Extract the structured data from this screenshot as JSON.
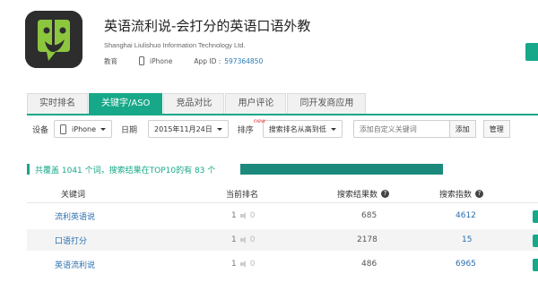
{
  "app": {
    "title": "英语流利说-会打分的英语口语外教",
    "company": "Shanghai Liulishuo Information Technology Ltd.",
    "category": "教育",
    "device": "iPhone",
    "app_id_label": "App ID :",
    "app_id": "597364850",
    "icon": "liulishuo-app-icon"
  },
  "tabs": [
    {
      "label": "实时排名",
      "active": false
    },
    {
      "label": "关键字/ASO",
      "active": true
    },
    {
      "label": "竞品对比",
      "active": false
    },
    {
      "label": "用户评论",
      "active": false
    },
    {
      "label": "同开发商应用",
      "active": false
    }
  ],
  "filters": {
    "device_label": "设备",
    "device_value": "iPhone",
    "date_label": "日期",
    "date_value": "2015年11月24日",
    "sort_label": "排序",
    "new_badge": "new",
    "sort_value": "搜索排名从高到低",
    "keyword_placeholder": "添加自定义关键词",
    "add_button": "添加",
    "manage_button": "管理"
  },
  "summary": {
    "text": "共覆盖 1041 个词，搜索结果在TOP10的有 83 个",
    "top10_fraction": 1.0
  },
  "table": {
    "headers": {
      "keyword": "关键词",
      "rank": "当前排名",
      "results": "搜索结果数",
      "index": "搜索指数",
      "help": "?"
    },
    "rows": [
      {
        "keyword": "流利英语说",
        "rank": "1",
        "rank_change": "0",
        "results": "685",
        "index": "4612"
      },
      {
        "keyword": "口语打分",
        "rank": "1",
        "rank_change": "0",
        "results": "2178",
        "index": "15"
      },
      {
        "keyword": "英语流利说",
        "rank": "1",
        "rank_change": "0",
        "results": "486",
        "index": "6965"
      }
    ]
  },
  "colors": {
    "accent": "#17a889",
    "link": "#2a6eb0",
    "progress": "#1b8a7c",
    "icon_green": "#8cc63f"
  }
}
